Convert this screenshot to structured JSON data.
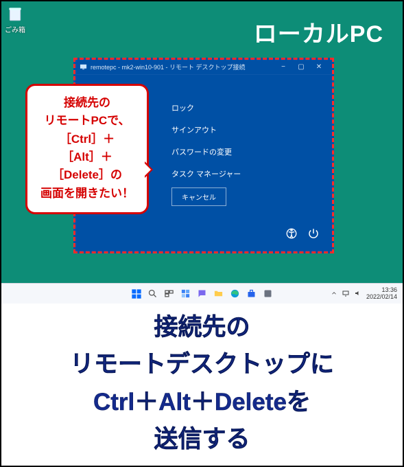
{
  "desktop": {
    "recycle_label": "ごみ箱",
    "local_pc_label": "ローカルPC"
  },
  "rdp": {
    "title": "remotepc - mk2-win10-901 - リモート デスクトップ接続",
    "menu": {
      "lock": "ロック",
      "signout": "サインアウト",
      "change_password": "パスワードの変更",
      "task_manager": "タスク マネージャー"
    },
    "cancel": "キャンセル"
  },
  "callout": {
    "l1": "接続先の",
    "l2": "リモートPCで、",
    "l3": "［Ctrl］＋",
    "l4": "［Alt］＋",
    "l5": "［Delete］の",
    "l6": "画面を開きたい！"
  },
  "taskbar": {
    "time": "13:36",
    "date": "2022/02/14"
  },
  "headline": {
    "l1": "接続先の",
    "l2": "リモートデスクトップに",
    "l3": "Ctrl＋Alt＋Deleteを",
    "l4": "送信する"
  }
}
